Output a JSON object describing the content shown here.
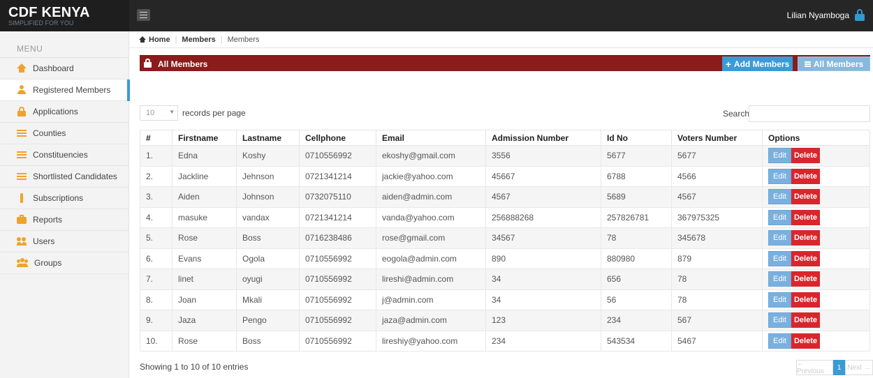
{
  "brand": {
    "title": "CDF KENYA",
    "subtitle": "SIMPLIFIED FOR YOU"
  },
  "user": {
    "name": "Lilian Nyamboga"
  },
  "sidebar": {
    "menu_label": "MENU",
    "items": [
      {
        "label": "Dashboard",
        "icon": "home-icon"
      },
      {
        "label": "Registered Members",
        "icon": "user-icon",
        "active": true
      },
      {
        "label": "Applications",
        "icon": "lock-icon"
      },
      {
        "label": "Counties",
        "icon": "list-icon"
      },
      {
        "label": "Constituencies",
        "icon": "list-icon"
      },
      {
        "label": "Shortlisted Candidates",
        "icon": "list-icon"
      },
      {
        "label": "Subscriptions",
        "icon": "bottle-icon"
      },
      {
        "label": "Reports",
        "icon": "briefcase-icon"
      },
      {
        "label": "Users",
        "icon": "users-icon"
      },
      {
        "label": "Groups",
        "icon": "group-icon"
      }
    ]
  },
  "breadcrumb": {
    "home": "Home",
    "section": "Members",
    "current": "Members"
  },
  "panel": {
    "title": "All Members",
    "add_button": "Add Members",
    "all_button": "All Members"
  },
  "controls": {
    "page_length": "10",
    "records_per_page": "records per page",
    "search_label": "Search:",
    "search_value": ""
  },
  "table": {
    "headers": [
      "#",
      "Firstname",
      "Lastname",
      "Cellphone",
      "Email",
      "Admission Number",
      "Id No",
      "Voters Number",
      "Options"
    ],
    "rows": [
      [
        "1.",
        "Edna",
        "Koshy",
        "0710556992",
        "ekoshy@gmail.com",
        "3556",
        "5677",
        "5677"
      ],
      [
        "2.",
        "Jackline",
        "Jehnson",
        "0721341214",
        "jackie@yahoo.com",
        "45667",
        "6788",
        "4566"
      ],
      [
        "3.",
        "Aiden",
        "Johnson",
        "0732075110",
        "aiden@admin.com",
        "4567",
        "5689",
        "4567"
      ],
      [
        "4.",
        "masuke",
        "vandax",
        "0721341214",
        "vanda@yahoo.com",
        "256888268",
        "257826781",
        "367975325"
      ],
      [
        "5.",
        "Rose",
        "Boss",
        "0716238486",
        "rose@gmail.com",
        "34567",
        "78",
        "345678"
      ],
      [
        "6.",
        "Evans",
        "Ogola",
        "0710556992",
        "eogola@admin.com",
        "890",
        "880980",
        "879"
      ],
      [
        "7.",
        "linet",
        "oyugi",
        "0710556992",
        "lireshi@admin.com",
        "34",
        "656",
        "78"
      ],
      [
        "8.",
        "Joan",
        "Mkali",
        "0710556992",
        "j@admin.com",
        "34",
        "56",
        "78"
      ],
      [
        "9.",
        "Jaza",
        "Pengo",
        "0710556992",
        "jaza@admin.com",
        "123",
        "234",
        "567"
      ],
      [
        "10.",
        "Rose",
        "Boss",
        "0710556992",
        "lireshiy@yahoo.com",
        "234",
        "543534",
        "5467"
      ]
    ],
    "edit_label": "Edit",
    "delete_label": "Delete"
  },
  "footer": {
    "info": "Showing 1 to 10 of 10 entries",
    "prev": "← Previous",
    "page": "1",
    "next": "Next →"
  },
  "colors": {
    "accent": "#3a9bd5",
    "panel_header": "#8c1b1b",
    "delete": "#d9262c",
    "icon": "#f0a22e"
  }
}
